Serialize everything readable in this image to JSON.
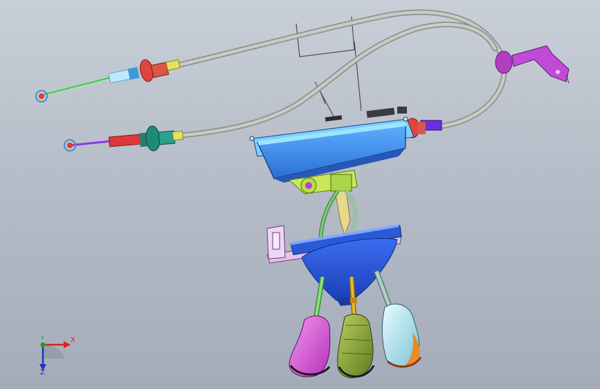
{
  "viewport": {
    "background_top": "#c9cfd8",
    "background_bottom": "#a4acba"
  },
  "triad": {
    "x_label": "X",
    "y_label": "Y",
    "z_label": "Z",
    "x_color": "#e02020",
    "y_color": "#20a020",
    "z_color": "#2230c8"
  },
  "model": {
    "cable_color": "#b9bcb8",
    "housing_color": "#3a8bf0",
    "base_color": "#d7b6e6",
    "knob_colors": [
      "#d95ad6",
      "#8db03b",
      "#a9dce6"
    ]
  }
}
